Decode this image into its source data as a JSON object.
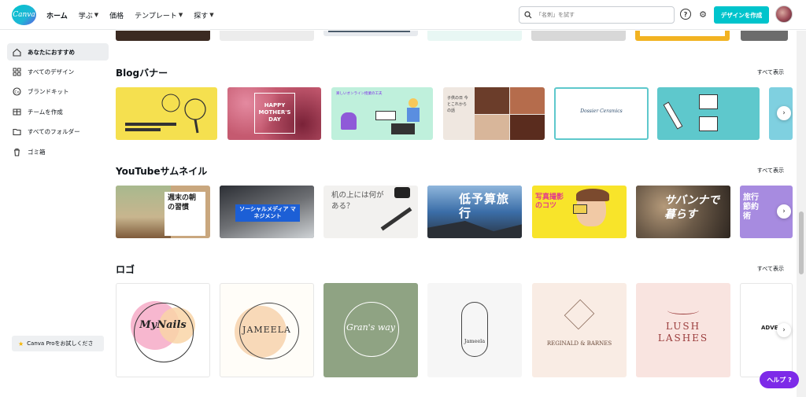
{
  "header": {
    "logo": "Canva",
    "nav": [
      {
        "label": "ホーム",
        "dropdown": false
      },
      {
        "label": "学ぶ",
        "dropdown": true
      },
      {
        "label": "価格",
        "dropdown": false
      },
      {
        "label": "テンプレート",
        "dropdown": true
      },
      {
        "label": "探す",
        "dropdown": true
      }
    ],
    "search_placeholder": "「名刺」を試す",
    "create_label": "デザインを作成"
  },
  "sidebar": {
    "items": [
      {
        "label": "あなたにおすすめ",
        "icon": "home-icon"
      },
      {
        "label": "すべてのデザイン",
        "icon": "grid-icon"
      },
      {
        "label": "ブランドキット",
        "icon": "brand-kit-icon"
      },
      {
        "label": "チームを作成",
        "icon": "team-icon"
      },
      {
        "label": "すべてのフォルダー",
        "icon": "folder-icon"
      },
      {
        "label": "ゴミ箱",
        "icon": "trash-icon"
      }
    ],
    "pro_label": "Canva Proをお試しくださ"
  },
  "sections": [
    {
      "title": "Blogバナー",
      "see_all": "すべて表示",
      "thumbs": [
        {
          "text": "",
          "bg": "#f5e04f"
        },
        {
          "text": "HAPPY MOTHER'S DAY",
          "bg": "#c55a70"
        },
        {
          "text": "楽しいオンライン授業の工夫",
          "bg": "#bff0dc"
        },
        {
          "text": "子供の日 今とこれから の話",
          "bg": "#efe7e0"
        },
        {
          "text": "Dossier Ceramics",
          "bg": "#ffffff"
        },
        {
          "text": "",
          "bg": "#5ec8cc"
        },
        {
          "text": "",
          "bg": "#7fd0e0"
        }
      ]
    },
    {
      "title": "YouTubeサムネイル",
      "see_all": "すべて表示",
      "thumbs": [
        {
          "text": "週末の朝の習慣",
          "bg": "#c9a77e"
        },
        {
          "text": "ソーシャルメディア マネジメント",
          "bg": "#4a4f57"
        },
        {
          "text": "机の上には何がある？",
          "bg": "#f2f1ef"
        },
        {
          "text": "低予算旅行",
          "bg": "#3b6ea8"
        },
        {
          "text": "写真撮影のコツ",
          "bg": "#f8e42a"
        },
        {
          "text": "サバンナで暮らす",
          "bg": "#6b5a48"
        },
        {
          "text": "旅行節約術",
          "bg": "#a78be0"
        }
      ]
    },
    {
      "title": "ロゴ",
      "see_all": "すべて表示",
      "thumbs": [
        {
          "text": "MyNails",
          "bg": "#ffffff"
        },
        {
          "text": "JAMEELA",
          "bg": "#fffdf8"
        },
        {
          "text": "Gran's way",
          "bg": "#8fa383"
        },
        {
          "text": "Jameela",
          "bg": "#f6f6f6"
        },
        {
          "text": "REGINALD & BARNES",
          "bg": "#f9ece4"
        },
        {
          "text": "LUSH LASHES",
          "bg": "#f9e4e0"
        },
        {
          "text": "ADVE",
          "bg": "#ffffff"
        }
      ]
    }
  ],
  "help_label": "ヘルプ ?"
}
